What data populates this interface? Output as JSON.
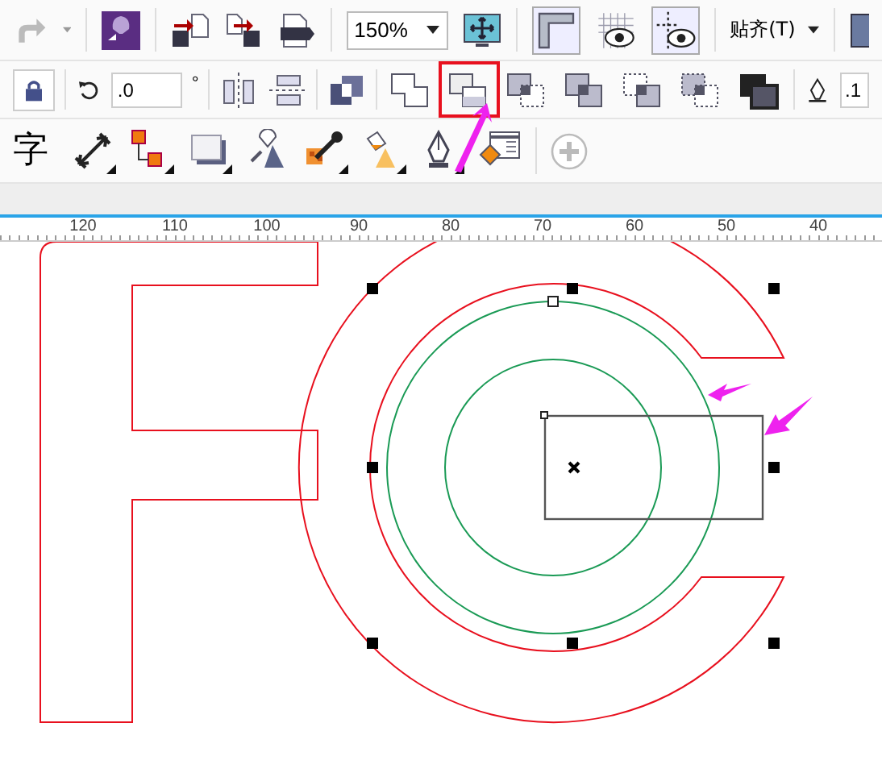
{
  "toolbar_top": {
    "zoom": "150%",
    "snap_label": "贴齐(T)"
  },
  "property_bar": {
    "rotation": ".0",
    "degree_unit": "°",
    "outline_width": ".1",
    "shaping_tools": [
      {
        "highlighted": false
      },
      {
        "highlighted": true
      },
      {
        "highlighted": false
      },
      {
        "highlighted": false
      },
      {
        "highlighted": false
      },
      {
        "highlighted": false
      },
      {
        "highlighted": false
      }
    ]
  },
  "toolbox": {
    "text_tool": "字"
  },
  "ruler": {
    "labels": [
      "120",
      "110",
      "100",
      "90",
      "80",
      "70",
      "60",
      "50",
      "40"
    ]
  }
}
